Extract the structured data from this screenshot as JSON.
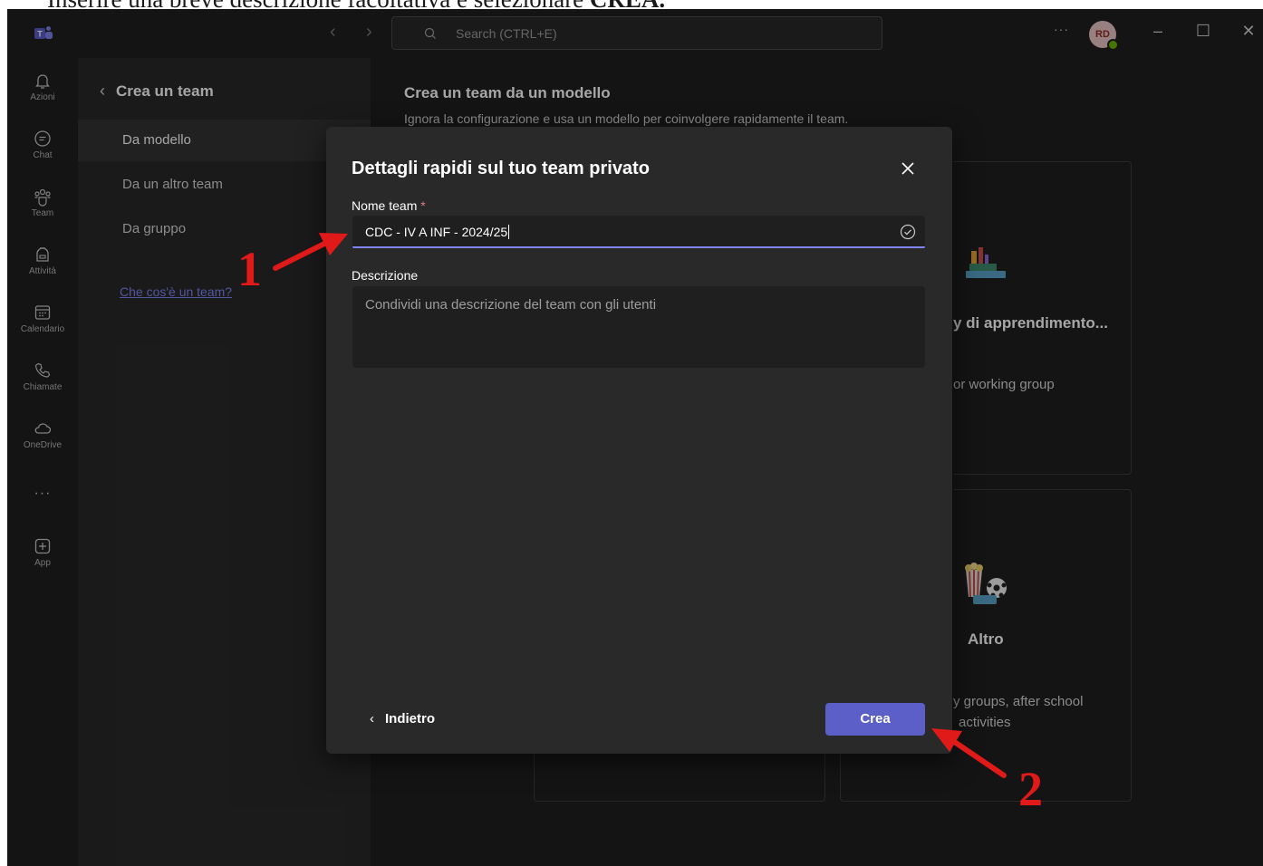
{
  "caption": {
    "text": "Inserire una breve descrizione facoltativa e selezionare",
    "bold": "CREA."
  },
  "titlebar": {
    "search_placeholder": "Search (CTRL+E)",
    "more": "···",
    "avatar_initials": "RD",
    "back_arrow": "‹",
    "forward_arrow": "›",
    "minimize": "–",
    "maximize": "☐",
    "close": "✕"
  },
  "rail": {
    "items": [
      {
        "label": "Azioni",
        "icon": "bell-icon"
      },
      {
        "label": "Chat",
        "icon": "chat-icon"
      },
      {
        "label": "Team",
        "icon": "team-icon"
      },
      {
        "label": "Attività",
        "icon": "backpack-icon"
      },
      {
        "label": "Calendario",
        "icon": "calendar-icon"
      },
      {
        "label": "Chiamate",
        "icon": "phone-icon"
      },
      {
        "label": "OneDrive",
        "icon": "cloud-icon"
      },
      {
        "label": "App",
        "icon": "plus-square-icon"
      }
    ],
    "more": "···"
  },
  "panel": {
    "back": "‹",
    "title": "Crea un team",
    "items": [
      "Da modello",
      "Da un altro team",
      "Da gruppo"
    ],
    "link": "Che cos'è un team?"
  },
  "main": {
    "title": "Crea un team da un modello",
    "subtitle": "Ignora la configurazione e usa un modello per coinvolgere rapidamente il team.",
    "card1": {
      "title": "y di apprendimento...",
      "text": "or working group"
    },
    "card2": {
      "title": "Altro",
      "text_line1": "y groups, after school",
      "text_line2": "activities"
    }
  },
  "dialog": {
    "title": "Dettagli rapidi sul tuo team privato",
    "name_label": "Nome team",
    "required_mark": "*",
    "name_value": "CDC - IV A INF - 2024/25",
    "desc_label": "Descrizione",
    "desc_placeholder": "Condividi una descrizione del team con gli utenti",
    "back_chevron": "‹",
    "back_label": "Indietro",
    "create_label": "Crea"
  },
  "annotations": {
    "step1": "1",
    "step2": "2",
    "color": "#e01919"
  },
  "colors": {
    "accent": "#5b5fc7",
    "link": "#7f85f5",
    "background": "#1f1f1f",
    "surface": "#292929"
  }
}
